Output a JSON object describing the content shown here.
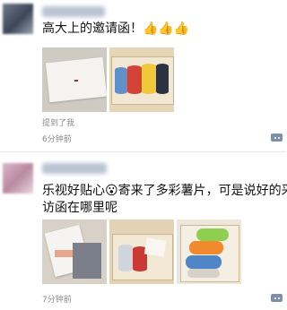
{
  "posts": [
    {
      "text": "高大上的邀请函！👍👍👍",
      "mention": "提到了我",
      "time": "6分钟前"
    },
    {
      "text_line1": "乐视好贴心😮寄来了多彩薯片，可是说好的采",
      "text_line2": "访函在哪里呢",
      "time": "7分钟前"
    }
  ],
  "icons": {
    "more": "more-dots-icon"
  },
  "colors": {
    "background": "#ffffff",
    "meta_text": "#8a8a8a",
    "more_button": "#7f8fa6"
  }
}
